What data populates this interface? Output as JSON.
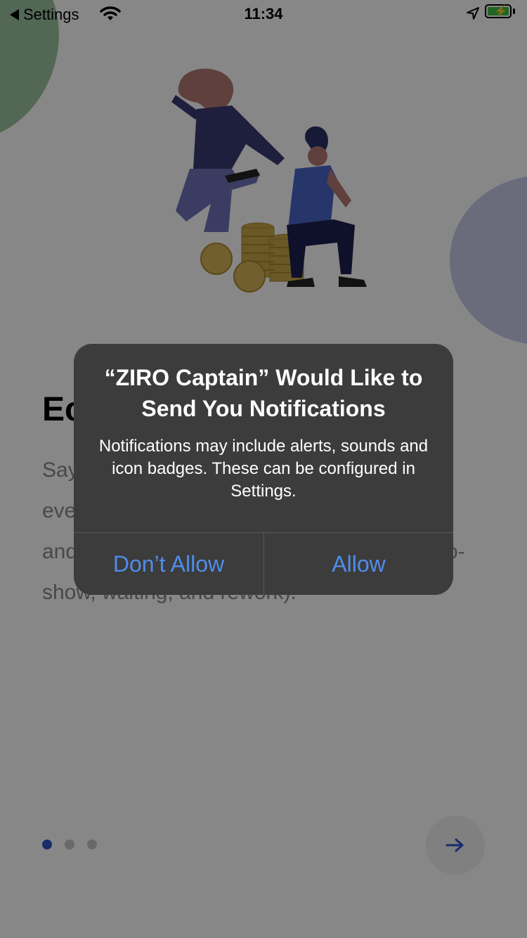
{
  "status_bar": {
    "back_label": "Settings",
    "time": "11:34",
    "icons": [
      "back-arrow-icon",
      "wifi-icon",
      "location-arrow-icon",
      "battery-charging-icon"
    ]
  },
  "onboarding": {
    "title_partial": "Ec",
    "body_fragments": [
      "Say",
      "eve",
      "and",
      "o-",
      "show, waiting, and rework)."
    ],
    "illustration": "people-celebrating-coins-illustration",
    "pager": {
      "total": 3,
      "active_index": 0
    },
    "next_icon": "arrow-right-icon",
    "colors": {
      "accent": "#2c56c8"
    }
  },
  "alert": {
    "title": "“ZIRO Captain” Would Like to Send You Notifications",
    "message": "Notifications may include alerts, sounds and icon badges. These can be configured in Settings.",
    "dont_allow_label": "Don’t Allow",
    "allow_label": "Allow",
    "colors": {
      "background": "#3c3c3c",
      "button_text": "#4f8dea"
    }
  }
}
